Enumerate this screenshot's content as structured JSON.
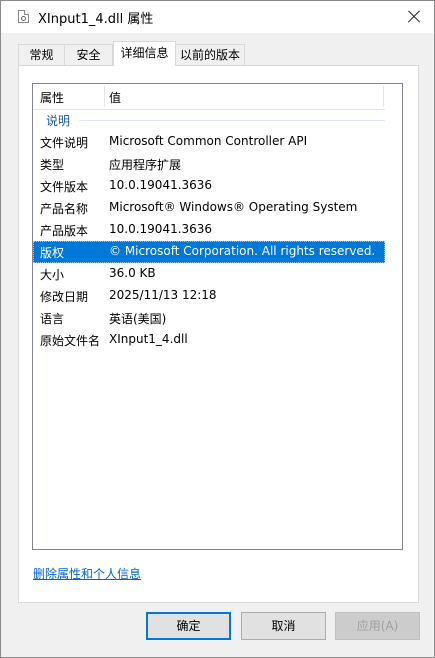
{
  "window": {
    "title": "XInput1_4.dll 属性"
  },
  "tabs": [
    {
      "label": "常规"
    },
    {
      "label": "安全"
    },
    {
      "label": "详细信息"
    },
    {
      "label": "以前的版本"
    }
  ],
  "details": {
    "header": {
      "property": "属性",
      "value": "值"
    },
    "group": "说明",
    "rows": [
      {
        "key": "文件说明",
        "value": "Microsoft Common Controller API"
      },
      {
        "key": "类型",
        "value": "应用程序扩展"
      },
      {
        "key": "文件版本",
        "value": "10.0.19041.3636"
      },
      {
        "key": "产品名称",
        "value": "Microsoft® Windows® Operating System"
      },
      {
        "key": "产品版本",
        "value": "10.0.19041.3636"
      },
      {
        "key": "版权",
        "value": "© Microsoft Corporation. All rights reserved."
      },
      {
        "key": "大小",
        "value": "36.0 KB"
      },
      {
        "key": "修改日期",
        "value": "2025/11/13 12:18"
      },
      {
        "key": "语言",
        "value": "英语(美国)"
      },
      {
        "key": "原始文件名",
        "value": "XInput1_4.dll"
      }
    ],
    "selected_row_key": "版权"
  },
  "links": {
    "remove_properties": "删除属性和个人信息"
  },
  "buttons": {
    "ok": "确定",
    "cancel": "取消",
    "apply": "应用(A)"
  },
  "colors": {
    "selection": "#0078d7",
    "link": "#0066cc",
    "group_label": "#1e5aa8"
  },
  "icons": {
    "title": "dll-file-icon",
    "close": "close-icon"
  }
}
